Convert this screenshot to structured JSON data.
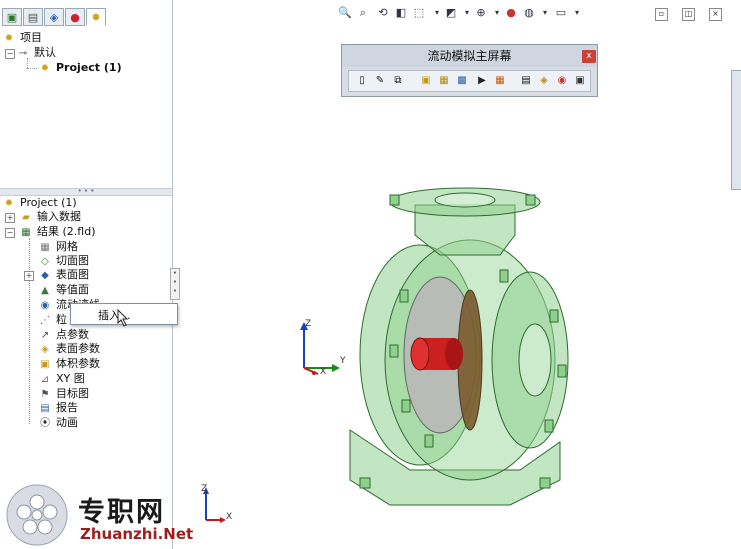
{
  "top_tree": {
    "root_label": "项目",
    "config_label": "默认",
    "project_label": "Project (1)"
  },
  "bottom_tree": {
    "root_label": "Project (1)",
    "items": [
      {
        "label": "输入数据",
        "icon": "input-data-icon"
      },
      {
        "label": "结果 (2.fld)",
        "icon": "results-icon"
      },
      {
        "label": "网格",
        "icon": "mesh-icon"
      },
      {
        "label": "切面图",
        "icon": "cut-plot-icon"
      },
      {
        "label": "表面图",
        "icon": "surface-plot-icon"
      },
      {
        "label": "等值面",
        "icon": "isosurface-icon"
      },
      {
        "label": "流动迹线",
        "icon": "flow-trajectory-icon"
      },
      {
        "label": "粒",
        "icon": "particle-study-icon"
      },
      {
        "label": "点参数",
        "icon": "point-params-icon"
      },
      {
        "label": "表面参数",
        "icon": "surface-params-icon"
      },
      {
        "label": "体积参数",
        "icon": "volume-params-icon"
      },
      {
        "label": "XY 图",
        "icon": "xy-plot-icon"
      },
      {
        "label": "目标图",
        "icon": "goal-plot-icon"
      },
      {
        "label": "报告",
        "icon": "report-icon"
      },
      {
        "label": "动画",
        "icon": "animation-icon"
      }
    ]
  },
  "context_menu": {
    "insert_label": "插入..."
  },
  "sim_window": {
    "title": "流动模拟主屏幕",
    "close": "x"
  },
  "triad_main": {
    "z": "Z",
    "y": "Y",
    "x": "X"
  },
  "triad_corner": {
    "z": "Z",
    "x": "X"
  },
  "watermark": {
    "brand_cn": "专职网",
    "url": "Zhuanzhi.Net"
  },
  "colors": {
    "model_green": "#6fbf73",
    "impeller_red": "#cc1f1f",
    "casing_gray": "#b8b8b8",
    "rotor_brown": "#7a5a2e"
  }
}
